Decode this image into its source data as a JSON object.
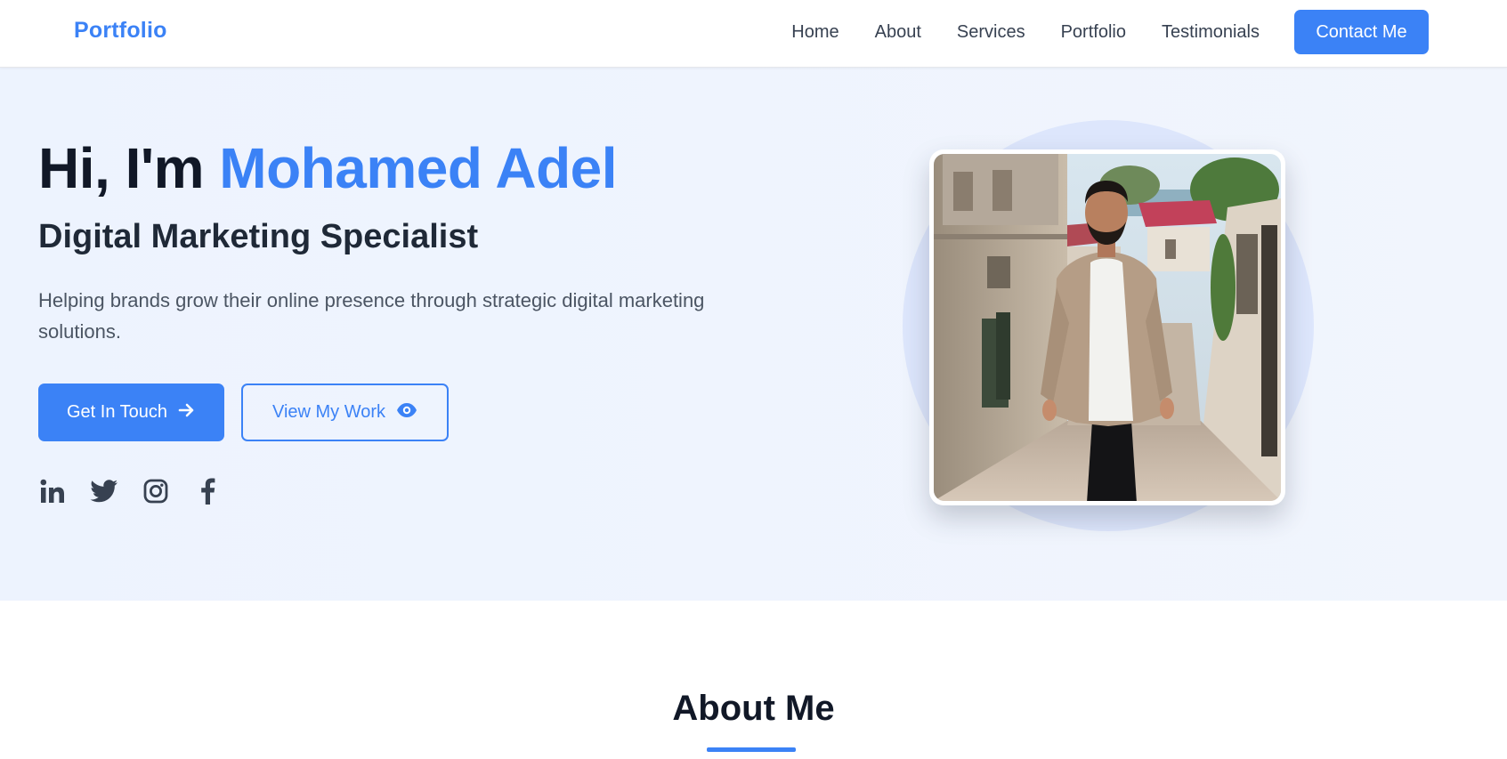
{
  "nav": {
    "brand": "Portfolio",
    "links": [
      "Home",
      "About",
      "Services",
      "Portfolio",
      "Testimonials"
    ],
    "cta": "Contact Me"
  },
  "hero": {
    "greeting": "Hi, I'm ",
    "name": "Mohamed Adel",
    "subtitle": "Digital Marketing Specialist",
    "description": "Helping brands grow their online presence through strategic digital marketing solutions.",
    "primary_button": "Get In Touch",
    "secondary_button": "View My Work",
    "socials": [
      "linkedin-icon",
      "twitter-icon",
      "instagram-icon",
      "facebook-icon"
    ]
  },
  "about": {
    "title": "About Me"
  },
  "colors": {
    "accent": "#3b82f6",
    "hero_bg": "#edf3fe",
    "text_dark": "#111827"
  }
}
